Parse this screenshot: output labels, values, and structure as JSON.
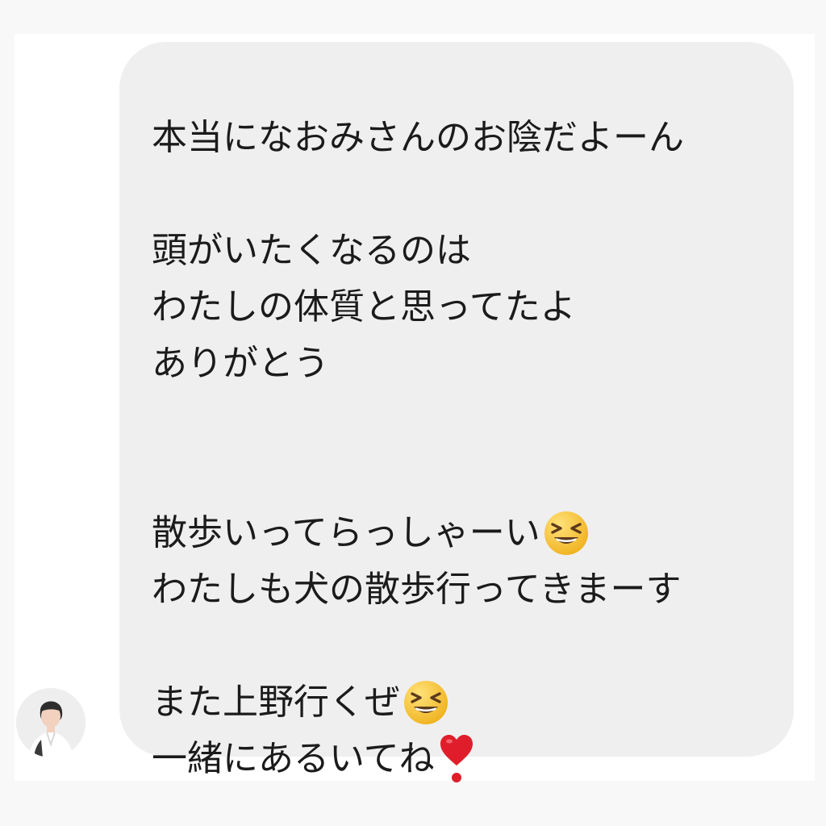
{
  "conversation": {
    "sender_avatar_label": "avatar",
    "message": {
      "line1": "本当になおみさんのお陰だよーん",
      "line2": "頭がいたくなるのは",
      "line3": "わたしの体質と思ってたよ",
      "line4": "ありがとう",
      "line5": "散歩いってらっしゃーい",
      "line6": "わたしも犬の散歩行ってきまーす",
      "line7": "また上野行くぜ",
      "line8": "一緒にあるいてね"
    },
    "emojis": {
      "laughing": "grinning-squinting-face-icon",
      "heart": "heavy-heart-exclamation-icon"
    },
    "colors": {
      "bubble_background": "#efeff0",
      "text": "#1b1b1b",
      "page_background": "#ffffff"
    }
  }
}
